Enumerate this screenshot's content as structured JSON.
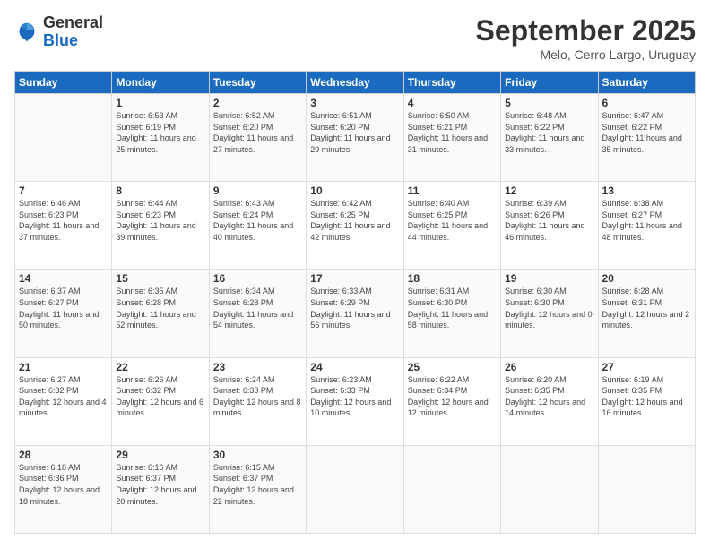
{
  "header": {
    "logo": {
      "line1": "General",
      "line2": "Blue"
    },
    "title": "September 2025",
    "subtitle": "Melo, Cerro Largo, Uruguay"
  },
  "weekdays": [
    "Sunday",
    "Monday",
    "Tuesday",
    "Wednesday",
    "Thursday",
    "Friday",
    "Saturday"
  ],
  "weeks": [
    [
      {
        "day": "",
        "sunrise": "",
        "sunset": "",
        "daylight": ""
      },
      {
        "day": "1",
        "sunrise": "Sunrise: 6:53 AM",
        "sunset": "Sunset: 6:19 PM",
        "daylight": "Daylight: 11 hours and 25 minutes."
      },
      {
        "day": "2",
        "sunrise": "Sunrise: 6:52 AM",
        "sunset": "Sunset: 6:20 PM",
        "daylight": "Daylight: 11 hours and 27 minutes."
      },
      {
        "day": "3",
        "sunrise": "Sunrise: 6:51 AM",
        "sunset": "Sunset: 6:20 PM",
        "daylight": "Daylight: 11 hours and 29 minutes."
      },
      {
        "day": "4",
        "sunrise": "Sunrise: 6:50 AM",
        "sunset": "Sunset: 6:21 PM",
        "daylight": "Daylight: 11 hours and 31 minutes."
      },
      {
        "day": "5",
        "sunrise": "Sunrise: 6:48 AM",
        "sunset": "Sunset: 6:22 PM",
        "daylight": "Daylight: 11 hours and 33 minutes."
      },
      {
        "day": "6",
        "sunrise": "Sunrise: 6:47 AM",
        "sunset": "Sunset: 6:22 PM",
        "daylight": "Daylight: 11 hours and 35 minutes."
      }
    ],
    [
      {
        "day": "7",
        "sunrise": "Sunrise: 6:46 AM",
        "sunset": "Sunset: 6:23 PM",
        "daylight": "Daylight: 11 hours and 37 minutes."
      },
      {
        "day": "8",
        "sunrise": "Sunrise: 6:44 AM",
        "sunset": "Sunset: 6:23 PM",
        "daylight": "Daylight: 11 hours and 39 minutes."
      },
      {
        "day": "9",
        "sunrise": "Sunrise: 6:43 AM",
        "sunset": "Sunset: 6:24 PM",
        "daylight": "Daylight: 11 hours and 40 minutes."
      },
      {
        "day": "10",
        "sunrise": "Sunrise: 6:42 AM",
        "sunset": "Sunset: 6:25 PM",
        "daylight": "Daylight: 11 hours and 42 minutes."
      },
      {
        "day": "11",
        "sunrise": "Sunrise: 6:40 AM",
        "sunset": "Sunset: 6:25 PM",
        "daylight": "Daylight: 11 hours and 44 minutes."
      },
      {
        "day": "12",
        "sunrise": "Sunrise: 6:39 AM",
        "sunset": "Sunset: 6:26 PM",
        "daylight": "Daylight: 11 hours and 46 minutes."
      },
      {
        "day": "13",
        "sunrise": "Sunrise: 6:38 AM",
        "sunset": "Sunset: 6:27 PM",
        "daylight": "Daylight: 11 hours and 48 minutes."
      }
    ],
    [
      {
        "day": "14",
        "sunrise": "Sunrise: 6:37 AM",
        "sunset": "Sunset: 6:27 PM",
        "daylight": "Daylight: 11 hours and 50 minutes."
      },
      {
        "day": "15",
        "sunrise": "Sunrise: 6:35 AM",
        "sunset": "Sunset: 6:28 PM",
        "daylight": "Daylight: 11 hours and 52 minutes."
      },
      {
        "day": "16",
        "sunrise": "Sunrise: 6:34 AM",
        "sunset": "Sunset: 6:28 PM",
        "daylight": "Daylight: 11 hours and 54 minutes."
      },
      {
        "day": "17",
        "sunrise": "Sunrise: 6:33 AM",
        "sunset": "Sunset: 6:29 PM",
        "daylight": "Daylight: 11 hours and 56 minutes."
      },
      {
        "day": "18",
        "sunrise": "Sunrise: 6:31 AM",
        "sunset": "Sunset: 6:30 PM",
        "daylight": "Daylight: 11 hours and 58 minutes."
      },
      {
        "day": "19",
        "sunrise": "Sunrise: 6:30 AM",
        "sunset": "Sunset: 6:30 PM",
        "daylight": "Daylight: 12 hours and 0 minutes."
      },
      {
        "day": "20",
        "sunrise": "Sunrise: 6:28 AM",
        "sunset": "Sunset: 6:31 PM",
        "daylight": "Daylight: 12 hours and 2 minutes."
      }
    ],
    [
      {
        "day": "21",
        "sunrise": "Sunrise: 6:27 AM",
        "sunset": "Sunset: 6:32 PM",
        "daylight": "Daylight: 12 hours and 4 minutes."
      },
      {
        "day": "22",
        "sunrise": "Sunrise: 6:26 AM",
        "sunset": "Sunset: 6:32 PM",
        "daylight": "Daylight: 12 hours and 6 minutes."
      },
      {
        "day": "23",
        "sunrise": "Sunrise: 6:24 AM",
        "sunset": "Sunset: 6:33 PM",
        "daylight": "Daylight: 12 hours and 8 minutes."
      },
      {
        "day": "24",
        "sunrise": "Sunrise: 6:23 AM",
        "sunset": "Sunset: 6:33 PM",
        "daylight": "Daylight: 12 hours and 10 minutes."
      },
      {
        "day": "25",
        "sunrise": "Sunrise: 6:22 AM",
        "sunset": "Sunset: 6:34 PM",
        "daylight": "Daylight: 12 hours and 12 minutes."
      },
      {
        "day": "26",
        "sunrise": "Sunrise: 6:20 AM",
        "sunset": "Sunset: 6:35 PM",
        "daylight": "Daylight: 12 hours and 14 minutes."
      },
      {
        "day": "27",
        "sunrise": "Sunrise: 6:19 AM",
        "sunset": "Sunset: 6:35 PM",
        "daylight": "Daylight: 12 hours and 16 minutes."
      }
    ],
    [
      {
        "day": "28",
        "sunrise": "Sunrise: 6:18 AM",
        "sunset": "Sunset: 6:36 PM",
        "daylight": "Daylight: 12 hours and 18 minutes."
      },
      {
        "day": "29",
        "sunrise": "Sunrise: 6:16 AM",
        "sunset": "Sunset: 6:37 PM",
        "daylight": "Daylight: 12 hours and 20 minutes."
      },
      {
        "day": "30",
        "sunrise": "Sunrise: 6:15 AM",
        "sunset": "Sunset: 6:37 PM",
        "daylight": "Daylight: 12 hours and 22 minutes."
      },
      {
        "day": "",
        "sunrise": "",
        "sunset": "",
        "daylight": ""
      },
      {
        "day": "",
        "sunrise": "",
        "sunset": "",
        "daylight": ""
      },
      {
        "day": "",
        "sunrise": "",
        "sunset": "",
        "daylight": ""
      },
      {
        "day": "",
        "sunrise": "",
        "sunset": "",
        "daylight": ""
      }
    ]
  ]
}
